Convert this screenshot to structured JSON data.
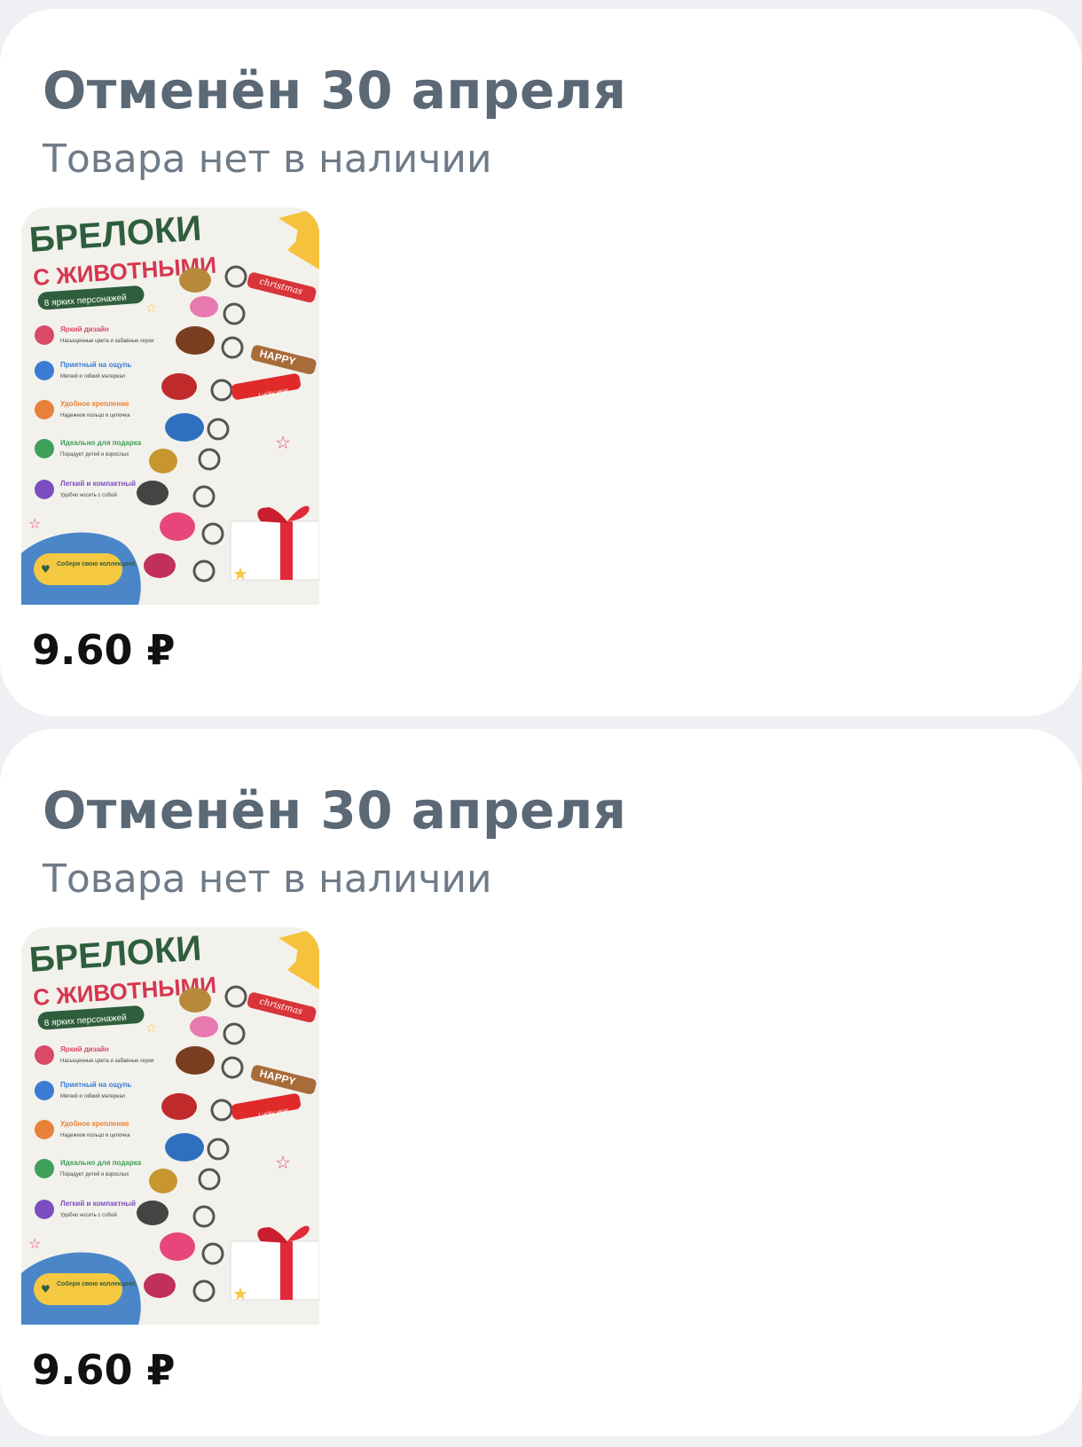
{
  "orders": [
    {
      "status_title": "Отменён 30 апреля",
      "status_subtitle": "Товара нет в наличии",
      "product": {
        "headline": "БРЕЛОКИ",
        "subheadline": "С ЖИВОТНЫМИ",
        "badge": "8 ярких персонажей",
        "features": [
          {
            "title": "Яркий дизайн",
            "text": "Насыщенные цвета и забавные герои"
          },
          {
            "title": "Приятный на ощупь",
            "text": "Мягкий и гибкий материал"
          },
          {
            "title": "Удобное крепление",
            "text": "Надежное кольцо и цепочка"
          },
          {
            "title": "Идеально для подарка",
            "text": "Порадует детей и взрослых"
          },
          {
            "title": "Легкий и компактный",
            "text": "Удобно носить с собой"
          }
        ],
        "tags": [
          "christmas",
          "HAPPY",
          "Lucky year"
        ],
        "footer_badge": "Собери свою коллекцию!"
      },
      "price": "9.60 ₽"
    },
    {
      "status_title": "Отменён 30 апреля",
      "status_subtitle": "Товара нет в наличии",
      "product": {
        "headline": "БРЕЛОКИ",
        "subheadline": "С ЖИВОТНЫМИ",
        "badge": "8 ярких персонажей",
        "features": [
          {
            "title": "Яркий дизайн",
            "text": "Насыщенные цвета и забавные герои"
          },
          {
            "title": "Приятный на ощупь",
            "text": "Мягкий и гибкий материал"
          },
          {
            "title": "Удобное крепление",
            "text": "Надежное кольцо и цепочка"
          },
          {
            "title": "Идеально для подарка",
            "text": "Порадует детей и взрослых"
          },
          {
            "title": "Легкий и компактный",
            "text": "Удобно носить с собой"
          }
        ],
        "tags": [
          "christmas",
          "HAPPY",
          "Lucky year"
        ],
        "footer_badge": "Собери свою коллекцию!"
      },
      "price": "9.60 ₽"
    }
  ],
  "colors": {
    "page_bg": "#eef0f3",
    "card_bg": "#ffffff",
    "title": "#5b6876",
    "subtitle": "#6f7b88",
    "price": "#111111",
    "poster_green": "#2f5e3c",
    "poster_blue": "#4a86c8",
    "poster_yellow": "#f5c842"
  }
}
